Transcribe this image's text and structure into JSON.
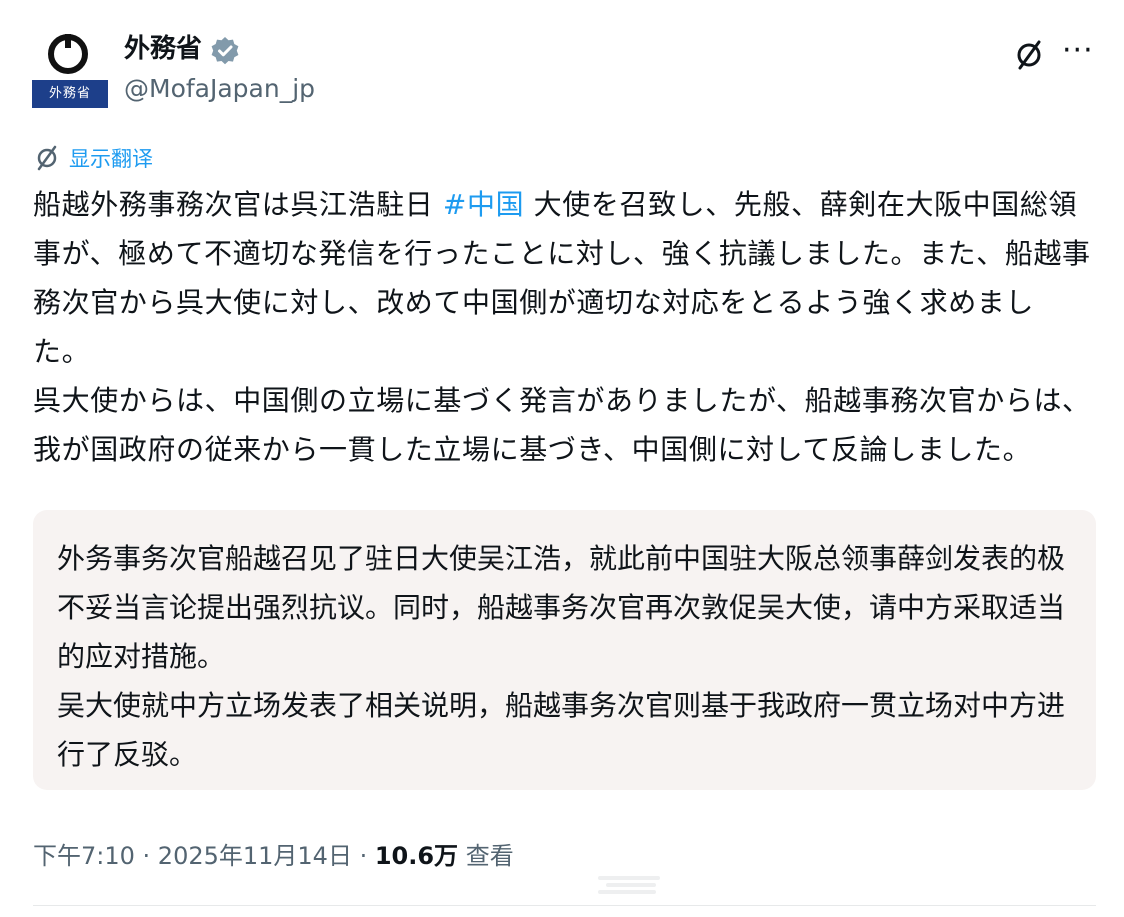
{
  "author": {
    "display_name": "外務省",
    "handle": "@MofaJapan_jp",
    "avatar_label": "外務省",
    "verified_color": "#829aab"
  },
  "translate": {
    "label": "显示翻译"
  },
  "tweet": {
    "text_before_hashtag": "船越外務事務次官は呉江浩駐日 ",
    "hashtag": "#中国",
    "text_after_hashtag": " 大使を召致し、先般、薛剣在大阪中国総領事が、極めて不適切な発信を行ったことに対し、強く抗議しました。また、船越事務次官から呉大使に対し、改めて中国側が適切な対応をとるよう強く求めました。\n呉大使からは、中国側の立場に基づく発言がありましたが、船越事務次官からは、我が国政府の従来から一貫した立場に基づき、中国側に対して反論しました。"
  },
  "translation": {
    "text": "外务事务次官船越召见了驻日大使吴江浩，就此前中国驻大阪总领事薛剑发表的极不妥当言论提出强烈抗议。同时，船越事务次官再次敦促吴大使，请中方采取适当的应对措施。\n吴大使就中方立场发表了相关说明，船越事务次官则基于我政府一贯立场对中方进行了反驳。"
  },
  "meta": {
    "time": "下午7:10",
    "separator": " · ",
    "date": "2025年11月14日",
    "views_count": "10.6万",
    "views_label": "查看"
  },
  "colors": {
    "accent": "#1d9bf0",
    "secondary_text": "#536471",
    "translation_bg": "#f7f3f2"
  }
}
